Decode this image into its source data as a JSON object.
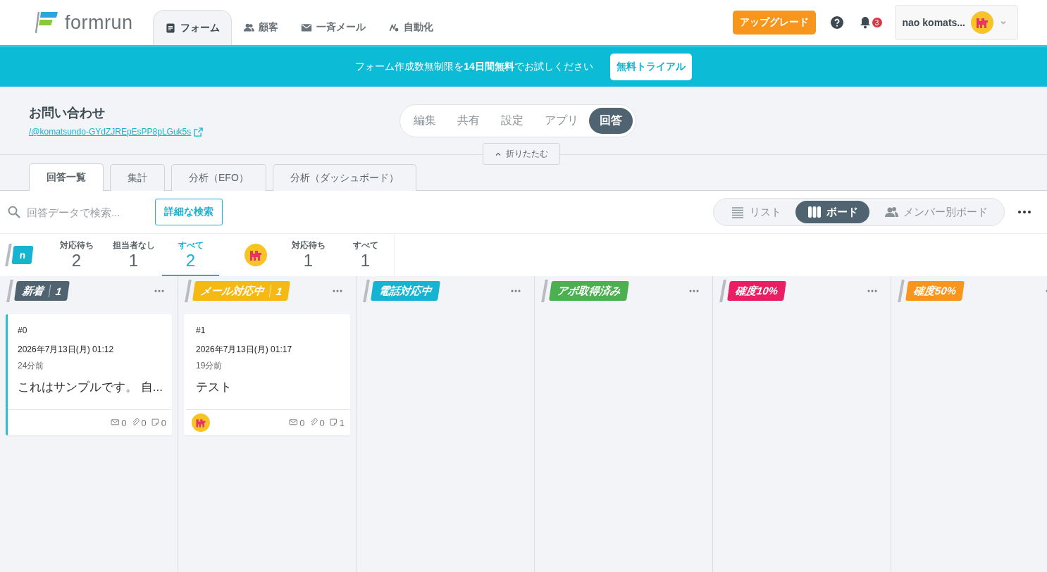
{
  "header": {
    "logo": "formrun",
    "nav": [
      {
        "label": "フォーム",
        "selected": true
      },
      {
        "label": "顧客",
        "selected": false
      },
      {
        "label": "一斉メール",
        "selected": false
      },
      {
        "label": "自動化",
        "selected": false
      }
    ],
    "upgrade": "アップグレード",
    "notification_count": "3",
    "user_name": "nao komats..."
  },
  "banner": {
    "text": "フォーム作成数無制限を**14日間無料**でお試しください",
    "button": "無料トライアル"
  },
  "form": {
    "title": "お問い合わせ",
    "url": "/@komatsundo-GYdZJREpEsPP8pLGuk5s",
    "segments": [
      {
        "label": "編集",
        "selected": false
      },
      {
        "label": "共有",
        "selected": false
      },
      {
        "label": "設定",
        "selected": false
      },
      {
        "label": "アプリ",
        "selected": false
      },
      {
        "label": "回答",
        "selected": true
      }
    ],
    "collapse": "折りたたむ"
  },
  "subtabs": [
    {
      "label": "回答一覧",
      "selected": true
    },
    {
      "label": "集計",
      "selected": false
    },
    {
      "label": "分析（EFO）",
      "selected": false
    },
    {
      "label": "分析（ダッシュボード）",
      "selected": false
    }
  ],
  "toolbar": {
    "search_placeholder": "回答データで検索...",
    "advanced_search": "詳細な検索",
    "views": [
      {
        "label": "リスト",
        "selected": false
      },
      {
        "label": "ボード",
        "selected": true
      },
      {
        "label": "メンバー別ボード",
        "selected": false
      }
    ]
  },
  "filters": [
    {
      "kind": "initial",
      "initial": "n",
      "items": [
        {
          "label": "対応待ち",
          "count": "2",
          "selected": false
        },
        {
          "label": "担当者なし",
          "count": "1",
          "selected": false
        },
        {
          "label": "すべて",
          "count": "2",
          "selected": true
        }
      ]
    },
    {
      "kind": "avatar",
      "items": [
        {
          "label": "対応待ち",
          "count": "1",
          "selected": false
        },
        {
          "label": "すべて",
          "count": "1",
          "selected": false
        }
      ]
    }
  ],
  "columns": [
    {
      "title": "新着",
      "count": "1",
      "color": "#4f6470",
      "cards": [
        {
          "number": "#0",
          "date": "2026年7月13日(月) 01:12",
          "ago": "24分前",
          "body": "これはサンプルです。 自...",
          "selected": true,
          "assignee": false,
          "stats": [
            {
              "kind": "mail",
              "count": "0"
            },
            {
              "kind": "attachment",
              "count": "0"
            },
            {
              "kind": "comment",
              "count": "0"
            }
          ]
        }
      ]
    },
    {
      "title": "メール対応中",
      "count": "1",
      "color": "#f5b914",
      "cards": [
        {
          "number": "#1",
          "date": "2026年7月13日(月) 01:17",
          "ago": "19分前",
          "body": "テスト",
          "selected": false,
          "assignee": true,
          "stats": [
            {
              "kind": "mail",
              "count": "0"
            },
            {
              "kind": "attachment",
              "count": "0"
            },
            {
              "kind": "comment",
              "count": "1"
            }
          ]
        }
      ]
    },
    {
      "title": "電話対応中",
      "color": "#14b4d2"
    },
    {
      "title": "アポ取得済み",
      "color": "#4caf50"
    },
    {
      "title": "確度10%",
      "color": "#e91e63"
    },
    {
      "title": "確度50%",
      "color": "#f7951d"
    }
  ]
}
